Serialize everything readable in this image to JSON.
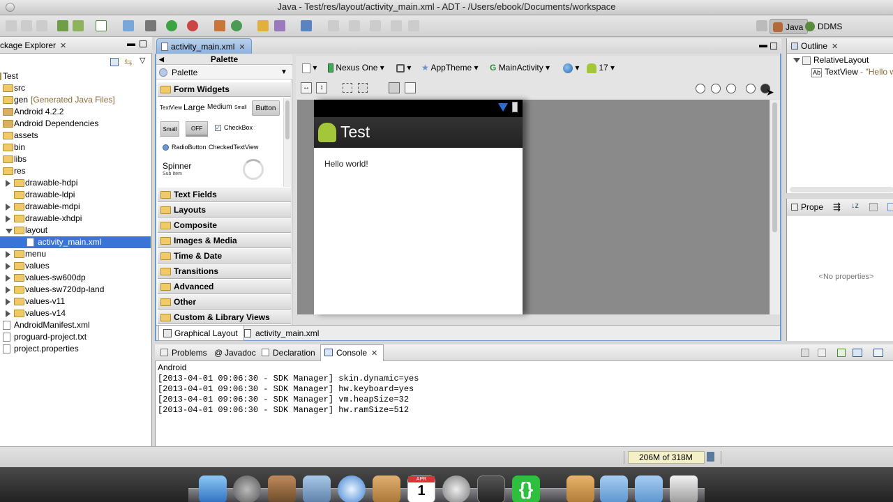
{
  "window": {
    "title": "Java - Test/res/layout/activity_main.xml - ADT - /Users/ebook/Documents/workspace"
  },
  "perspectives": {
    "java": "Java",
    "ddms": "DDMS"
  },
  "package_explorer": {
    "title": "ckage Explorer",
    "project": "Test",
    "items": [
      {
        "label": "src",
        "extra": ""
      },
      {
        "label": "gen",
        "extra": "[Generated Java Files]"
      },
      {
        "label": "Android 4.2.2",
        "extra": ""
      },
      {
        "label": "Android Dependencies",
        "extra": ""
      },
      {
        "label": "assets",
        "extra": ""
      },
      {
        "label": "bin",
        "extra": ""
      },
      {
        "label": "libs",
        "extra": ""
      },
      {
        "label": "res",
        "extra": ""
      },
      {
        "label": "drawable-hdpi",
        "extra": ""
      },
      {
        "label": "drawable-ldpi",
        "extra": ""
      },
      {
        "label": "drawable-mdpi",
        "extra": ""
      },
      {
        "label": "drawable-xhdpi",
        "extra": ""
      },
      {
        "label": "layout",
        "extra": ""
      },
      {
        "label": "activity_main.xml",
        "extra": ""
      },
      {
        "label": "menu",
        "extra": ""
      },
      {
        "label": "values",
        "extra": ""
      },
      {
        "label": "values-sw600dp",
        "extra": ""
      },
      {
        "label": "values-sw720dp-land",
        "extra": ""
      },
      {
        "label": "values-v11",
        "extra": ""
      },
      {
        "label": "values-v14",
        "extra": ""
      },
      {
        "label": "AndroidManifest.xml",
        "extra": ""
      },
      {
        "label": "proguard-project.txt",
        "extra": ""
      },
      {
        "label": "project.properties",
        "extra": ""
      }
    ]
  },
  "editor": {
    "tab": "activity_main.xml",
    "palette_header": "Palette",
    "palette_title": "Palette",
    "categories": [
      "Form Widgets",
      "Text Fields",
      "Layouts",
      "Composite",
      "Images & Media",
      "Time & Date",
      "Transitions",
      "Advanced",
      "Other",
      "Custom & Library Views"
    ],
    "widgets": {
      "textview": "TextView",
      "large": "Large",
      "medium": "Medium",
      "small": "Small",
      "button": "Button",
      "small_btn": "Small",
      "off": "OFF",
      "checkbox": "CheckBox",
      "radio": "RadioButton",
      "checkedtext": "CheckedTextView",
      "spinner": "Spinner",
      "subitem": "Sub Item"
    },
    "config": {
      "device": "Nexus One",
      "theme": "AppTheme",
      "activity": "MainActivity",
      "api": "17"
    },
    "device_preview": {
      "app_title": "Test",
      "hello": "Hello world!"
    },
    "bottom_tabs": [
      "Graphical Layout",
      "activity_main.xml"
    ]
  },
  "outline": {
    "title": "Outline",
    "root": "RelativeLayout",
    "child": "TextView",
    "child_extra": "- \"Hello w"
  },
  "properties": {
    "title": "Prope",
    "empty": "<No properties>"
  },
  "bottom_panel": {
    "tabs": [
      "Problems",
      "Javadoc",
      "Declaration",
      "Console"
    ],
    "console_name": "Android",
    "lines": [
      "[2013-04-01 09:06:30 - SDK Manager] skin.dynamic=yes",
      "[2013-04-01 09:06:30 - SDK Manager] hw.keyboard=yes",
      "[2013-04-01 09:06:30 - SDK Manager] vm.heapSize=32",
      "[2013-04-01 09:06:30 - SDK Manager] hw.ramSize=512"
    ]
  },
  "status": {
    "memory": "206M of 318M"
  },
  "dock": {
    "calendar_month": "APR",
    "calendar_day": "1"
  },
  "colors": {
    "selection": "#3875d7",
    "accent": "#6b9bd1",
    "android_green": "#a4c639"
  }
}
